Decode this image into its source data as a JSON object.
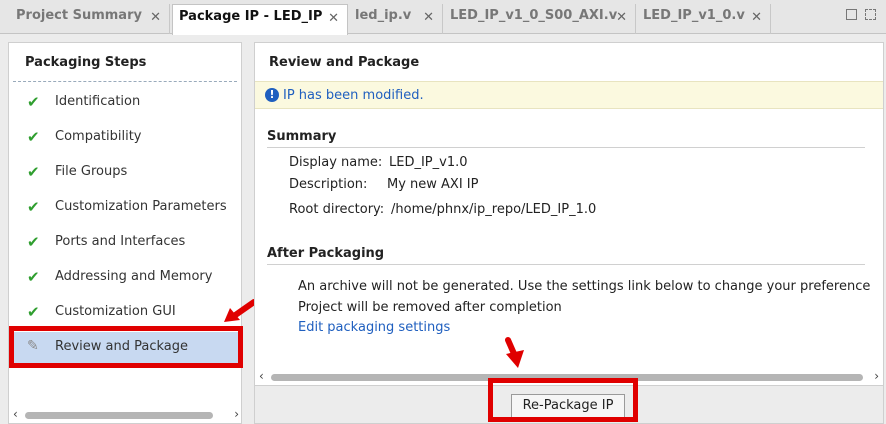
{
  "tabs": [
    {
      "label": "Project Summary",
      "close": "✕"
    },
    {
      "label": "Package IP - LED_IP",
      "close": "✕"
    },
    {
      "label": "led_ip.v",
      "close": "✕"
    },
    {
      "label": "LED_IP_v1_0_S00_AXI.v",
      "close": "✕"
    },
    {
      "label": "LED_IP_v1_0.v",
      "close": "✕"
    }
  ],
  "sidebar": {
    "title": "Packaging Steps",
    "steps": [
      {
        "label": "Identification",
        "icon": "check-icon"
      },
      {
        "label": "Compatibility",
        "icon": "check-icon"
      },
      {
        "label": "File Groups",
        "icon": "check-icon"
      },
      {
        "label": "Customization Parameters",
        "icon": "check-icon"
      },
      {
        "label": "Ports and Interfaces",
        "icon": "check-icon"
      },
      {
        "label": "Addressing and Memory",
        "icon": "check-icon"
      },
      {
        "label": "Customization GUI",
        "icon": "check-icon"
      },
      {
        "label": "Review and Package",
        "icon": "pencil-icon"
      }
    ]
  },
  "main": {
    "title": "Review and Package",
    "info": "IP has been modified.",
    "summary": {
      "title": "Summary",
      "display_name_label": "Display name:",
      "display_name_value": "LED_IP_v1.0",
      "description_label": "Description:",
      "description_value": "My new AXI IP",
      "root_label": "Root directory:",
      "root_value": "/home/phnx/ip_repo/LED_IP_1.0"
    },
    "after": {
      "title": "After Packaging",
      "line1": "An archive will not be generated. Use the settings link below to change your preference",
      "line2": "Project will be removed after completion",
      "link": "Edit packaging settings"
    },
    "button_label": "Re-Package IP"
  },
  "colors": {
    "highlight": "#e00000",
    "check": "#2f9e2f",
    "link": "#1f5fbf",
    "selected": "#c8d9f1"
  }
}
